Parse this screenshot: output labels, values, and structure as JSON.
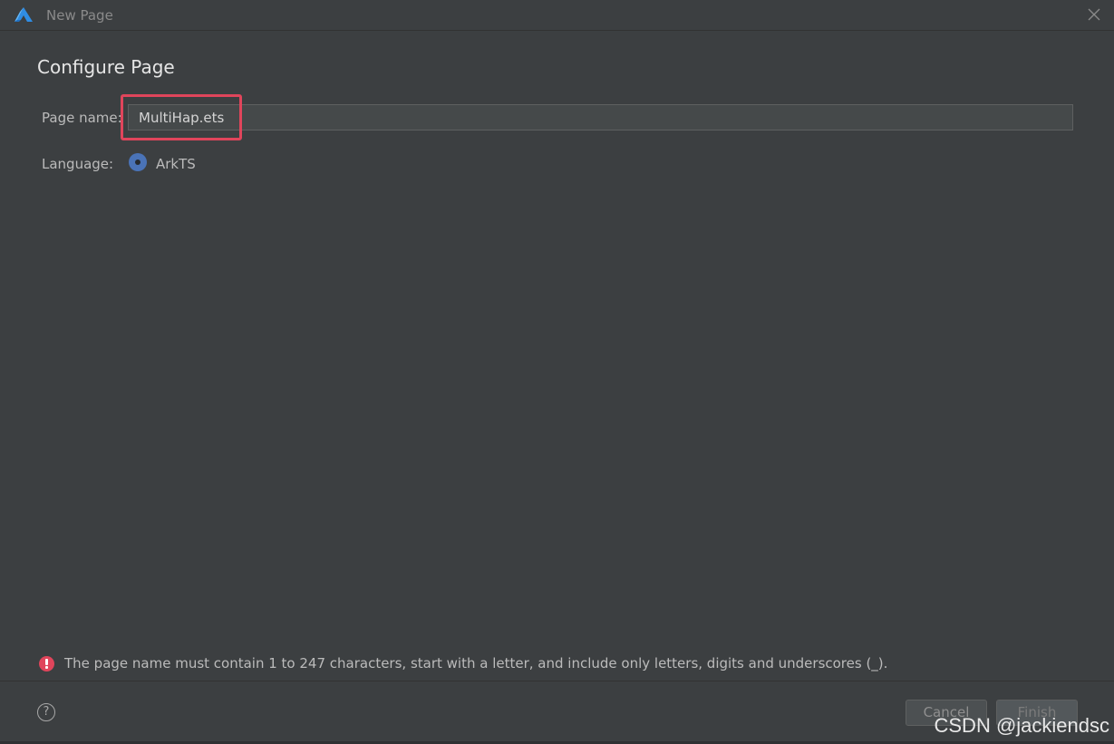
{
  "window": {
    "title": "New Page",
    "logo_icon": "huawei-devstudio-logo-icon",
    "close_icon": "close-icon"
  },
  "page": {
    "heading": "Configure Page"
  },
  "form": {
    "page_name_label": "Page name:",
    "page_name_value": "MultiHap.ets",
    "language_label": "Language:",
    "language_option": "ArkTS"
  },
  "error": {
    "icon": "error-icon",
    "message": "The page name must contain 1 to 247 characters, start with a letter, and include only letters, digits and underscores (_)."
  },
  "footer": {
    "help_label": "?",
    "cancel_label": "Cancel",
    "finish_label": "Finish"
  },
  "watermark": "CSDN @jackiendsc",
  "colors": {
    "background": "#3c3f41",
    "accent_radio": "#4a73b7",
    "highlight": "#e0455b",
    "error": "#e0455b"
  }
}
